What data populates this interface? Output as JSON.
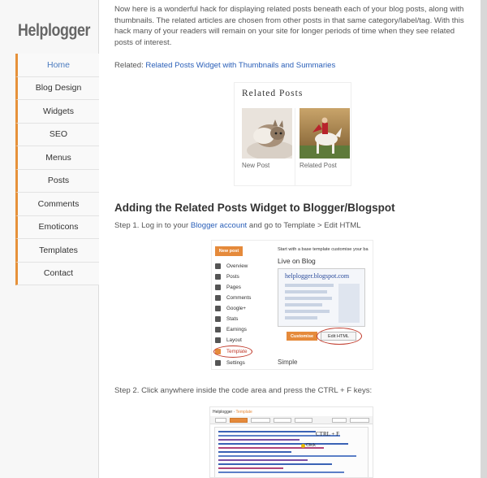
{
  "site": {
    "logo": "Helplogger"
  },
  "nav": {
    "items": [
      {
        "label": "Home"
      },
      {
        "label": "Blog Design"
      },
      {
        "label": "Widgets"
      },
      {
        "label": "SEO"
      },
      {
        "label": "Menus"
      },
      {
        "label": "Posts"
      },
      {
        "label": "Comments"
      },
      {
        "label": "Emoticons"
      },
      {
        "label": "Templates"
      },
      {
        "label": "Contact"
      }
    ]
  },
  "article": {
    "intro": "Now here is a wonderful hack for displaying related posts beneath each of your blog posts, along with thumbnails. The related articles are chosen from other posts in that same category/label/tag. With this hack many of your readers will remain on your site for longer periods of time when they see related posts of interest.",
    "related_prefix": "Related: ",
    "related_link": "Related Posts Widget with Thumbnails and Summaries",
    "heading": "Adding the Related Posts Widget to Blogger/Blogspot",
    "step1_prefix": "Step 1. Log in to your ",
    "step1_link": "Blogger account",
    "step1_suffix": " and go to Template > Edit HTML",
    "step2": "Step 2. Click anywhere inside the code area and press the CTRL + F keys:"
  },
  "related_widget": {
    "title": "Related Posts",
    "items": [
      {
        "caption": "New Post"
      },
      {
        "caption": "Related Post"
      }
    ]
  },
  "screenshot1": {
    "new_post": "New post",
    "top_line": "Start with a base template customise your ba",
    "live_on_blog": "Live on Blog",
    "blog_title": "helplogger.blogspot.com",
    "customise": "Customise",
    "edit_html": "Edit HTML",
    "simple": "Simple",
    "menu": [
      {
        "label": "Overview"
      },
      {
        "label": "Posts"
      },
      {
        "label": "Pages"
      },
      {
        "label": "Comments"
      },
      {
        "label": "Google+"
      },
      {
        "label": "Stats"
      },
      {
        "label": "Earnings"
      },
      {
        "label": "Layout"
      },
      {
        "label": "Template"
      },
      {
        "label": "Settings"
      }
    ]
  },
  "screenshot2": {
    "crumb_site": "Helplogger",
    "crumb_sep": " · ",
    "crumb_page": "Template",
    "ctrl_f": "CTRL + F",
    "click": "Click"
  },
  "colors": {
    "accent_orange": "#e58a3b",
    "link_blue": "#2a5fb8",
    "oval_red": "#c03a2b"
  }
}
